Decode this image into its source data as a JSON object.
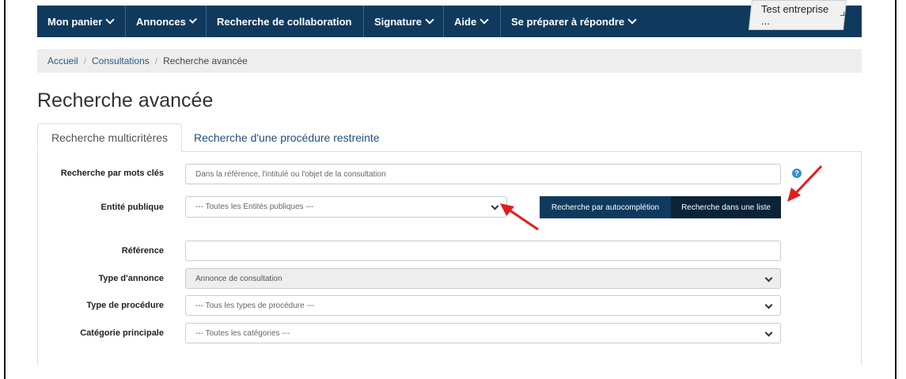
{
  "nav": {
    "items": [
      {
        "label": "Mon panier",
        "dropdown": true
      },
      {
        "label": "Annonces",
        "dropdown": true
      },
      {
        "label": "Recherche de collaboration",
        "dropdown": false
      },
      {
        "label": "Signature",
        "dropdown": true
      },
      {
        "label": "Aide",
        "dropdown": true
      },
      {
        "label": "Se préparer à répondre",
        "dropdown": true
      }
    ],
    "user_menu": "Test entreprise ..."
  },
  "breadcrumb": {
    "home": "Accueil",
    "section": "Consultations",
    "current": "Recherche avancée"
  },
  "page_title": "Recherche avancée",
  "tabs": {
    "active": "Recherche multicritères",
    "inactive": "Recherche d'une procédure restreinte"
  },
  "form": {
    "keywords": {
      "label": "Recherche par mots clés",
      "placeholder": "Dans la référence, l'intitulé ou l'objet de la consultation"
    },
    "entity": {
      "label": "Entité publique",
      "value": "--- Toutes les Entités publiques ---"
    },
    "btn_autocomplete": "Recherche par autocomplétion",
    "btn_list": "Recherche dans une liste",
    "reference": {
      "label": "Référence",
      "value": ""
    },
    "ad_type": {
      "label": "Type d'annonce",
      "value": "Annonce de consultation"
    },
    "procedure_type": {
      "label": "Type de procédure",
      "value": "--- Tous les types de procédure ---"
    },
    "category": {
      "label": "Catégorie principale",
      "value": "--- Toutes les catégories ---"
    }
  },
  "icons": {
    "help": "question-circle-icon",
    "arrow_color": "#e11d1d"
  },
  "colors": {
    "nav": "#0f3a5e",
    "link": "#265a88"
  }
}
